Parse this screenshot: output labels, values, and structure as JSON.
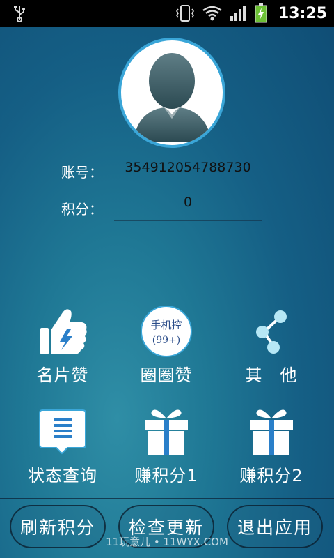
{
  "status_bar": {
    "time": "13:25",
    "icons": [
      "usb-icon",
      "vibrate-icon",
      "wifi-icon",
      "signal-icon",
      "battery-charging-icon"
    ]
  },
  "profile": {
    "account_label": "账号：",
    "account_value": "354912054788730",
    "points_label": "积分：",
    "points_value": "0"
  },
  "grid": [
    {
      "label": "名片赞",
      "icon": "thumbs-up-icon"
    },
    {
      "label": "圈圈赞",
      "icon": "phone-control-badge-icon",
      "badge_line1": "手机控",
      "badge_line2": "(99+)"
    },
    {
      "label": "其　他",
      "icon": "share-icon"
    },
    {
      "label": "状态查询",
      "icon": "message-list-icon"
    },
    {
      "label": "赚积分1",
      "icon": "gift-icon"
    },
    {
      "label": "赚积分2",
      "icon": "gift-icon"
    }
  ],
  "bottom_buttons": [
    {
      "label": "刷新积分"
    },
    {
      "label": "检查更新"
    },
    {
      "label": "退出应用"
    }
  ],
  "watermark": "11玩意儿 • 11WYX.COM",
  "colors": {
    "accent": "#3aa6d8",
    "background": "#1f7895"
  }
}
